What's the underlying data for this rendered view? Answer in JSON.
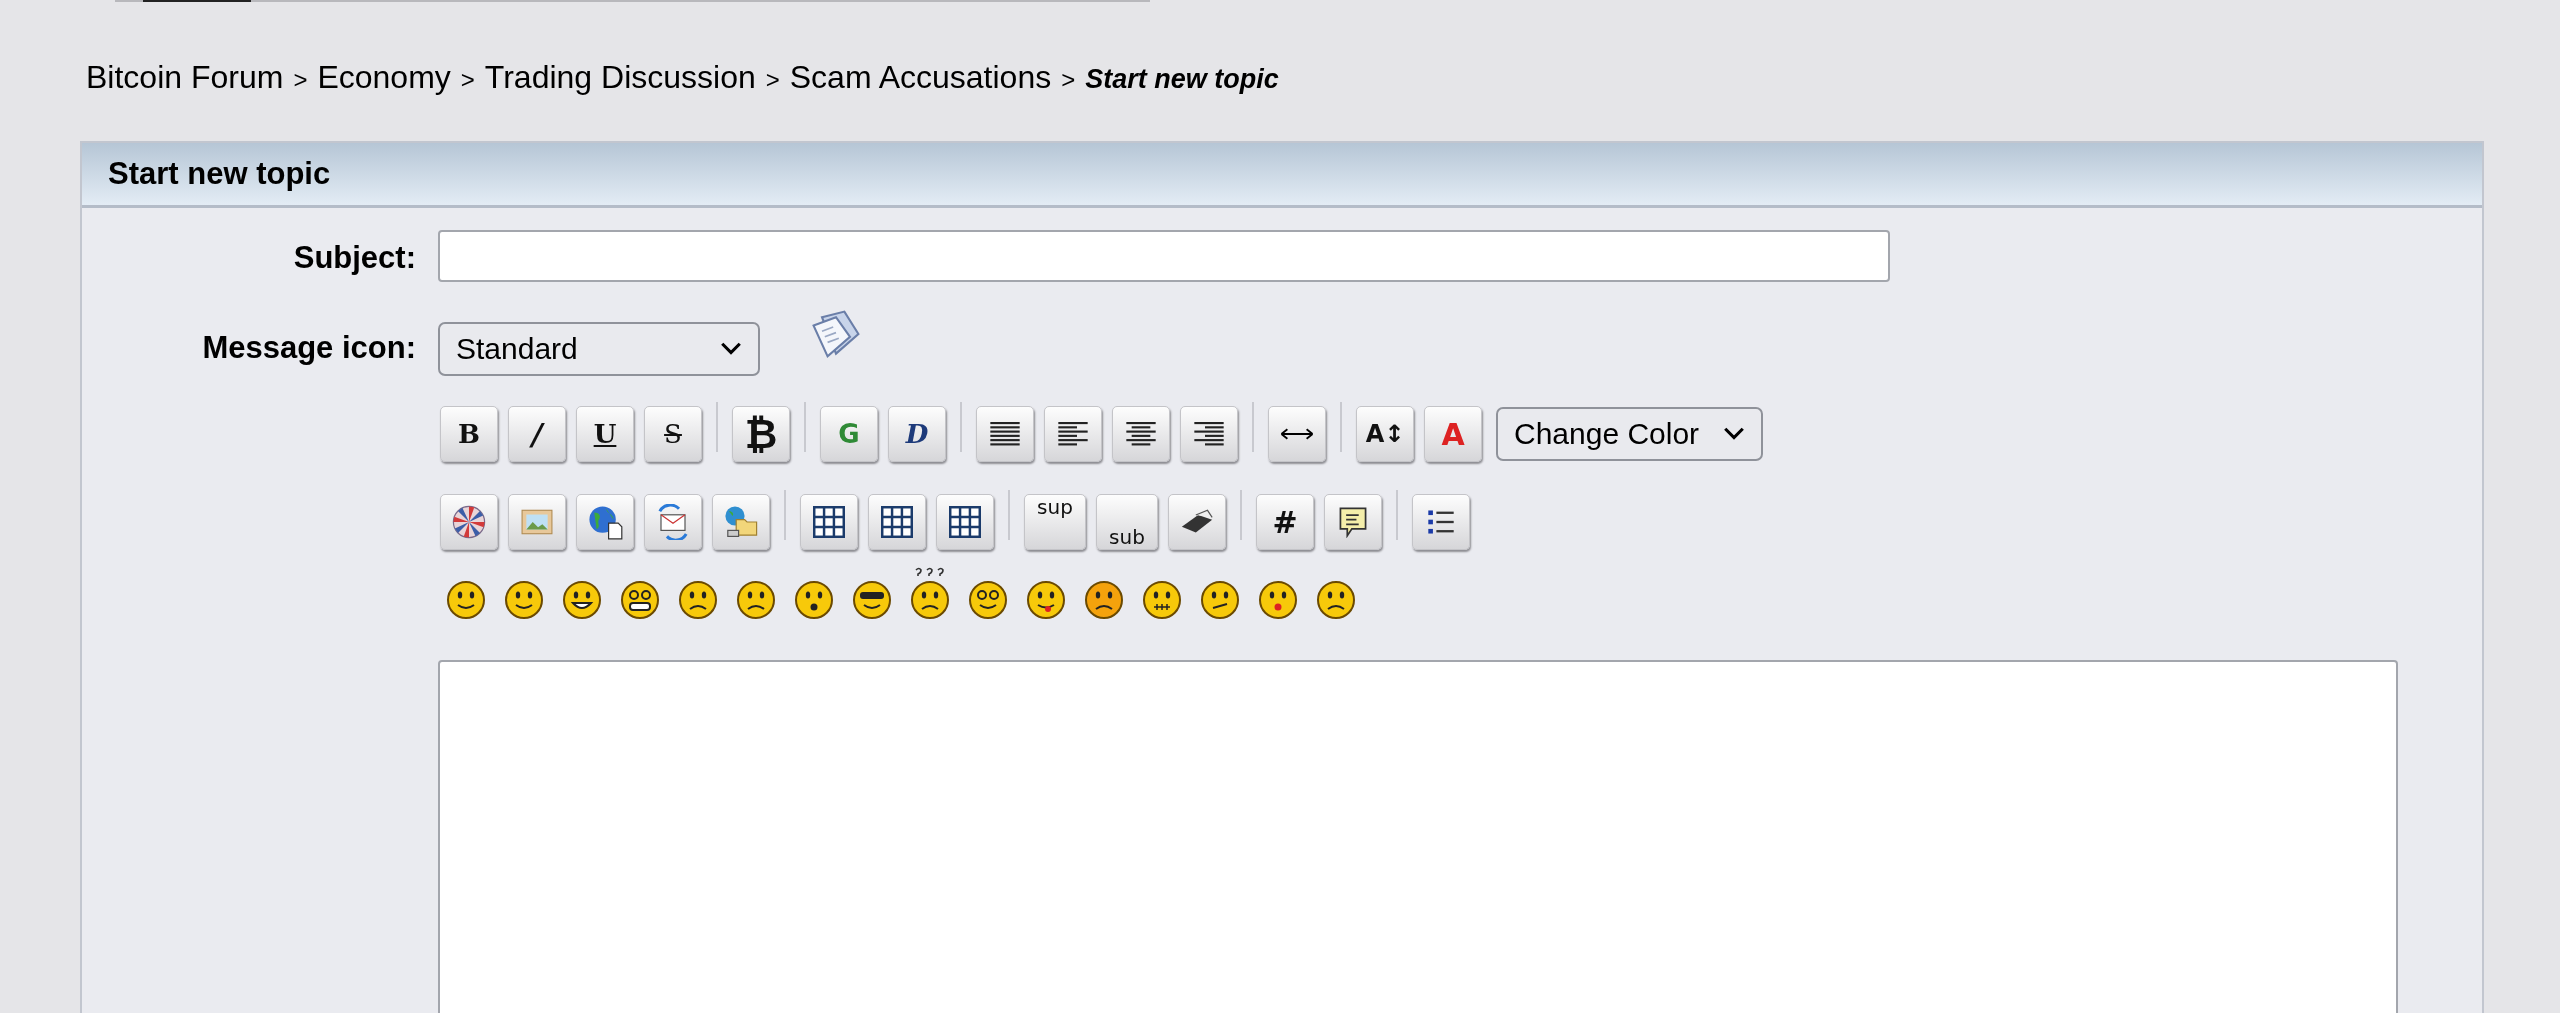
{
  "breadcrumbs": [
    {
      "label": "Bitcoin Forum",
      "current": false
    },
    {
      "label": "Economy",
      "current": false
    },
    {
      "label": "Trading Discussion",
      "current": false
    },
    {
      "label": "Scam Accusations",
      "current": false
    },
    {
      "label": "Start new topic",
      "current": true
    }
  ],
  "breadcrumb_separator": ">",
  "panel": {
    "title": "Start new topic"
  },
  "form": {
    "subject_label": "Subject:",
    "message_icon_label": "Message icon:",
    "message_icon_value": "Standard",
    "color_value": "Change Color"
  },
  "toolbar_rows": [
    [
      {
        "kind": "bold",
        "glyph": "B"
      },
      {
        "kind": "italic",
        "glyph": "/"
      },
      {
        "kind": "underline",
        "glyph": "U"
      },
      {
        "kind": "strike",
        "glyph": "S"
      },
      {
        "kind": "separator"
      },
      {
        "kind": "bitcoin",
        "glyph": "₿"
      },
      {
        "kind": "separator"
      },
      {
        "kind": "glow",
        "glyph": "G"
      },
      {
        "kind": "shadow",
        "glyph": "D"
      },
      {
        "kind": "separator"
      },
      {
        "kind": "justify"
      },
      {
        "kind": "alignleft"
      },
      {
        "kind": "aligncenter"
      },
      {
        "kind": "alignright"
      },
      {
        "kind": "separator"
      },
      {
        "kind": "rule"
      },
      {
        "kind": "separator"
      },
      {
        "kind": "size",
        "glyph": "A↕"
      },
      {
        "kind": "color",
        "glyph": "A"
      }
    ],
    [
      {
        "kind": "flash"
      },
      {
        "kind": "image"
      },
      {
        "kind": "globe"
      },
      {
        "kind": "email"
      },
      {
        "kind": "ftp"
      },
      {
        "kind": "separator"
      },
      {
        "kind": "table"
      },
      {
        "kind": "table"
      },
      {
        "kind": "table"
      },
      {
        "kind": "separator"
      },
      {
        "kind": "sup",
        "glyph": "sup"
      },
      {
        "kind": "sub",
        "glyph": "sub"
      },
      {
        "kind": "typewriter"
      },
      {
        "kind": "separator"
      },
      {
        "kind": "code",
        "glyph": "#"
      },
      {
        "kind": "quote"
      },
      {
        "kind": "separator"
      },
      {
        "kind": "list"
      }
    ]
  ]
}
